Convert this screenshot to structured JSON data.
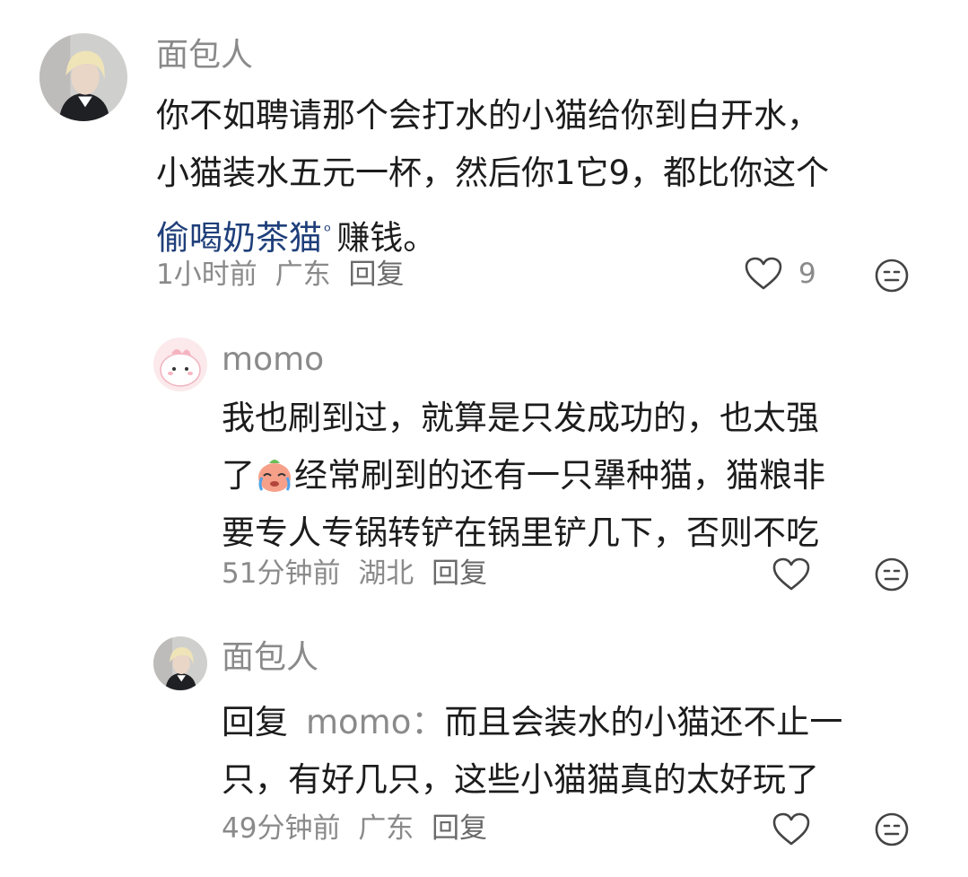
{
  "comments": [
    {
      "username": "面包人",
      "lines": [
        "你不如聘请那个会打水的小猫给你到白开水，",
        "小猫装水五元一杯，然后你1它9，都比你这个"
      ],
      "line3_link": "偷喝奶茶猫",
      "line3_rest": "赚钱。",
      "search_icon": "search-icon",
      "time": "1小时前",
      "location": "广东",
      "reply_label": "回复",
      "like_count": "9"
    },
    {
      "username": "momo",
      "lines": [
        "我也刷到过，就算是只发成功的，也太强",
        "经常刷到的还有一只犟种猫，猫粮非",
        "要专人专锅转铲在锅里铲几下，否则不吃"
      ],
      "line2_prefix": "了",
      "emoji_icon": "crying-emoji-icon",
      "time": "51分钟前",
      "location": "湖北",
      "reply_label": "回复"
    },
    {
      "username": "面包人",
      "reply_prefix": "回复",
      "reply_target": "momo",
      "reply_colon": "：",
      "lines": [
        "而且会装水的小猫还不止一",
        "只，有好几只，这些小猫猫真的太好玩了"
      ],
      "time": "49分钟前",
      "location": "广东",
      "reply_label": "回复"
    }
  ],
  "icons": {
    "like": "heart-outline-icon",
    "emoji": "smiley-face-icon"
  }
}
